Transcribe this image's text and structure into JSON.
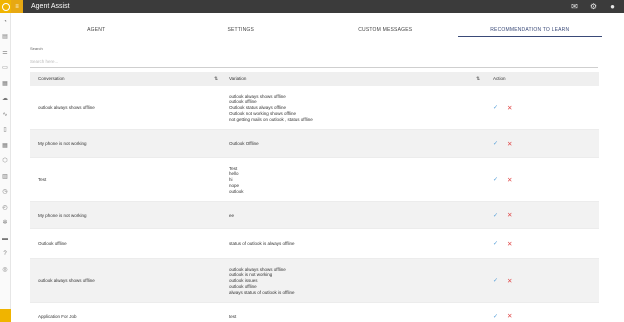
{
  "app": {
    "title": "Agent Assist"
  },
  "tabs": [
    {
      "label": "AGENT"
    },
    {
      "label": "SETTINGS"
    },
    {
      "label": "CUSTOM MESSAGES"
    },
    {
      "label": "RECOMMENDATION TO LEARN"
    }
  ],
  "active_tab": "RECOMMENDATION TO LEARN",
  "search": {
    "label": "Search",
    "placeholder": "Search here...",
    "value": ""
  },
  "table": {
    "columns": [
      "Conversation",
      "Variation",
      "Action"
    ],
    "rows": [
      {
        "conversation": "outlook always shows offline",
        "variations": [
          "outlook always shows offline",
          "outlook offline",
          "Outlook status always offline",
          "Outlook not working shows offline",
          "not getting mails on outlook , status offline"
        ]
      },
      {
        "conversation": "My phone is not working",
        "variations": [
          "Outlook Offline"
        ]
      },
      {
        "conversation": "Test",
        "variations": [
          "Test",
          "hello",
          "hi",
          "nope",
          "outlook"
        ]
      },
      {
        "conversation": "My phone is not working",
        "variations": [
          "ee"
        ]
      },
      {
        "conversation": "Outlook offline",
        "variations": [
          "status of outlook is always offline"
        ]
      },
      {
        "conversation": "outlook always shows offline",
        "variations": [
          "outlook always shows offline",
          "outlook is not working",
          "outlook issues",
          "outlook offline",
          "always status of outlook is offline"
        ]
      },
      {
        "conversation": "Application For Job",
        "variations": [
          "test"
        ]
      }
    ]
  },
  "colors": {
    "topbar": "#3b3b3b",
    "accent": "#f0b400",
    "approve": "#58a0d8",
    "reject": "#e04848",
    "active_tab": "#3a4a78"
  }
}
